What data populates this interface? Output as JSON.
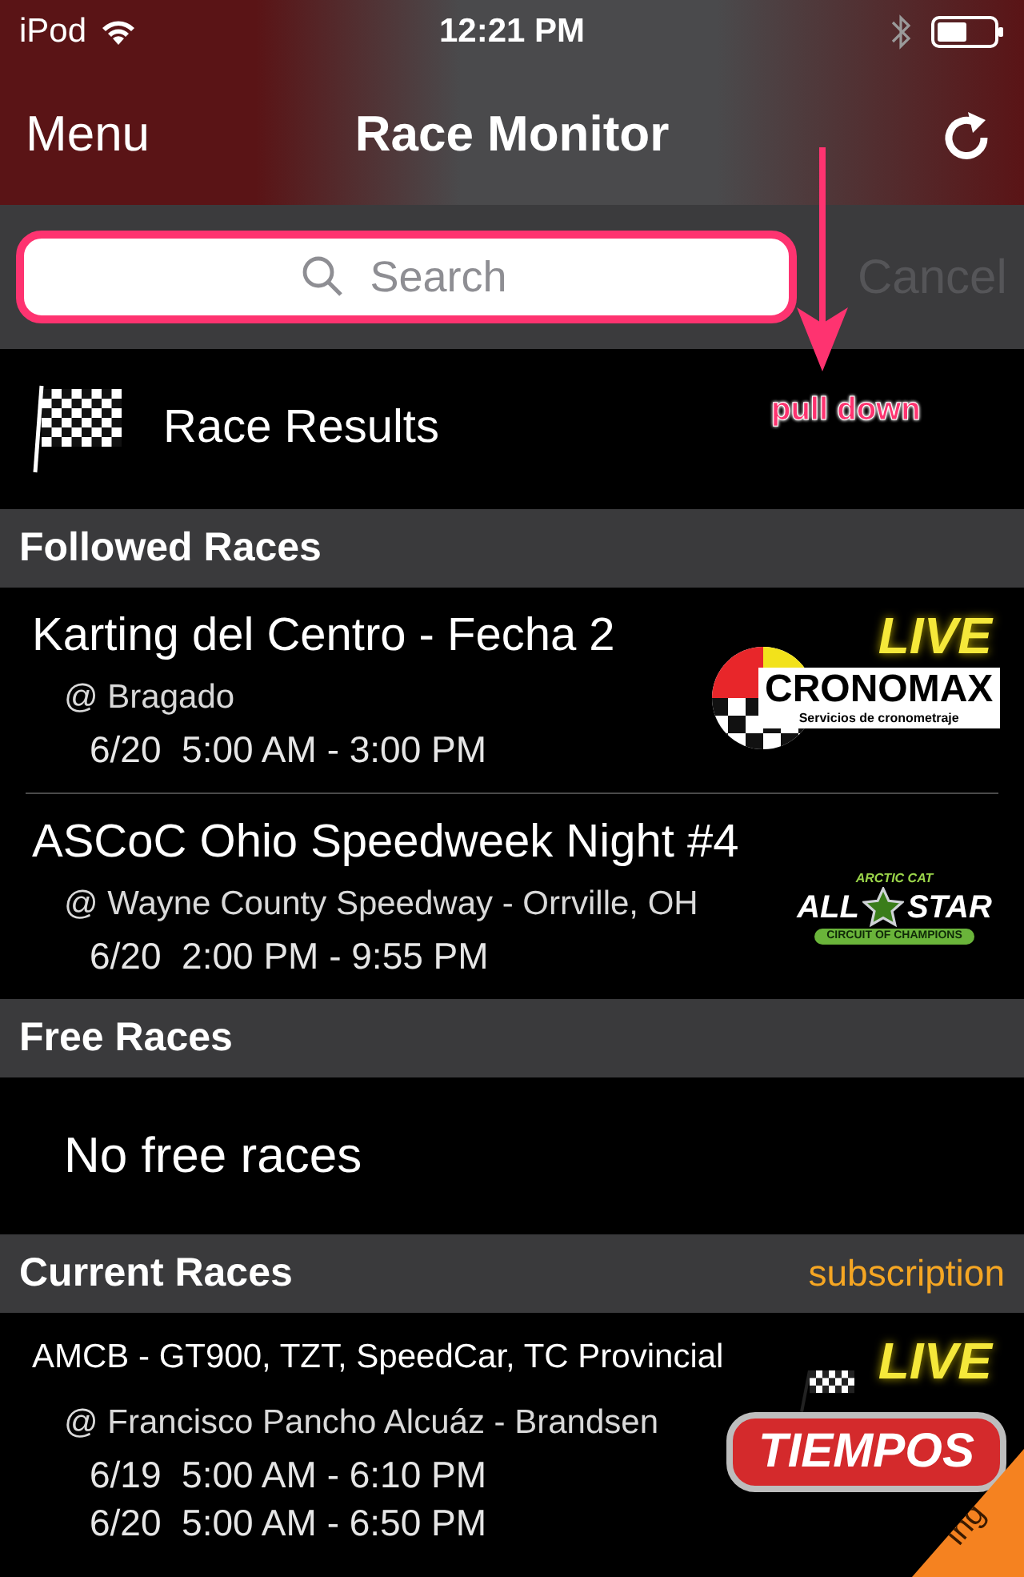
{
  "status_bar": {
    "device": "iPod",
    "time": "12:21 PM"
  },
  "nav": {
    "left": "Menu",
    "title": "Race Monitor"
  },
  "search": {
    "placeholder": "Search",
    "cancel": "Cancel"
  },
  "annotation": {
    "text": "pull down"
  },
  "race_results": {
    "label": "Race Results"
  },
  "sections": [
    {
      "title": "Followed Races",
      "races": [
        {
          "name": "Karting del Centro - Fecha 2",
          "venue": "@ Bragado",
          "dates": [
            "6/20  5:00 AM - 3:00 PM"
          ],
          "badge": "LIVE",
          "logo": {
            "kind": "cronomax",
            "texts": [
              "CRONOMAX",
              "Servicios de cronometraje"
            ]
          }
        },
        {
          "name": "ASCoC Ohio Speedweek Night #4",
          "venue": "@ Wayne County Speedway - Orrville, OH",
          "dates": [
            "6/20  2:00 PM - 9:55 PM"
          ],
          "logo": {
            "kind": "allstar",
            "texts": [
              "ARCTIC CAT",
              "ALL",
              "STAR",
              "CIRCUIT OF CHAMPIONS"
            ]
          }
        }
      ]
    },
    {
      "title": "Free Races",
      "empty": "No free races"
    },
    {
      "title": "Current Races",
      "link": "subscription",
      "small": true,
      "races": [
        {
          "name": "AMCB - GT900, TZT, SpeedCar, TC Provincial",
          "venue": "@ Francisco Pancho Alcuáz - Brandsen",
          "dates": [
            "6/19  5:00 AM - 6:10 PM",
            "6/20  5:00 AM - 6:50 PM"
          ],
          "badge": "LIVE",
          "logo": {
            "kind": "tiempos",
            "texts": [
              "TIEMPOS"
            ]
          }
        }
      ]
    }
  ],
  "corner_ribbon": {
    "text": "ing"
  }
}
